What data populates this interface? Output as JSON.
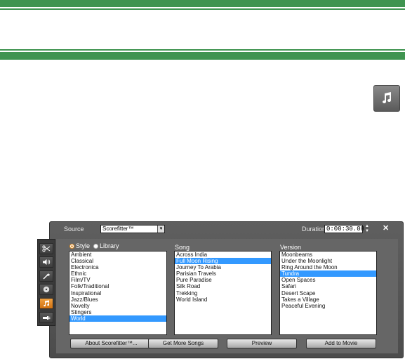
{
  "panel": {
    "source_label": "Source",
    "source_value": "Scorefitter™",
    "duration_label": "Duration",
    "duration_value": "0:00:30.08",
    "close_glyph": "✕"
  },
  "mode": {
    "style_label": "Style",
    "library_label": "Library",
    "selected": "Style"
  },
  "columns": {
    "style_header": "",
    "song_header": "Song",
    "version_header": "Version"
  },
  "styles": [
    "Ambient",
    "Classical",
    "Electronica",
    "Ethnic",
    "Film/TV",
    "Folk/Traditional",
    "Inspirational",
    "Jazz/Blues",
    "Novelty",
    "Stingers",
    "World"
  ],
  "styles_selected": "World",
  "songs": [
    "Across India",
    "Full Moon Rising",
    "Journey To Arabia",
    "Parisian Travels",
    "Pure Paradise",
    "Silk Road",
    "Trekking",
    "World Island"
  ],
  "songs_selected": "Full Moon Rising",
  "versions": [
    "Moonbeams",
    "Under the Moonlight",
    "Ring Around the Moon",
    "Tundra",
    "Open Spaces",
    "Safari",
    "Desert Scape",
    "Takes a Village",
    "Peaceful Evening"
  ],
  "versions_selected": "Tundra",
  "buttons": {
    "about": "About Scorefitter™...",
    "get_more": "Get More Songs",
    "preview": "Preview",
    "add": "Add to Movie"
  },
  "sidebar_icons": [
    "scissors-icon",
    "speaker-icon",
    "magic-wand-icon",
    "disc-icon",
    "music-note-icon",
    "plug-icon"
  ],
  "colors": {
    "accent_green": "#3f9450",
    "selection_blue": "#3399ff",
    "active_orange": "#e08a20"
  }
}
